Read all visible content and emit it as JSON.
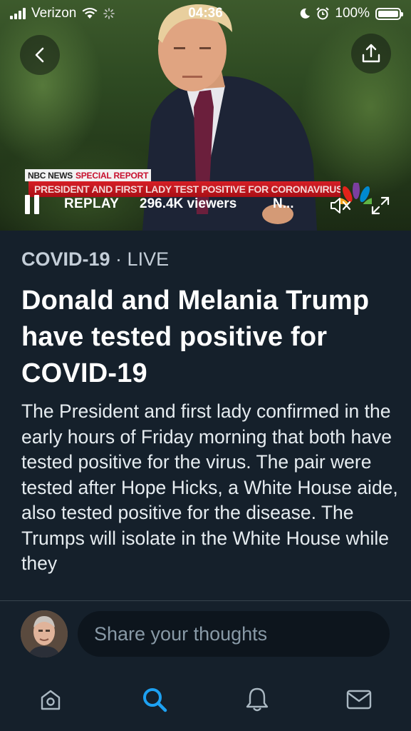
{
  "status_bar": {
    "carrier": "Verizon",
    "time": "04:36",
    "battery": "100%"
  },
  "video": {
    "banner_brand": "NBC NEWS",
    "banner_label": "SPECIAL REPORT",
    "ticker": "PRESIDENT AND FIRST LADY TEST POSITIVE FOR CORONAVIRUS",
    "replay_label": "REPLAY",
    "viewers": "296.4K viewers",
    "truncated_title": "N..."
  },
  "article": {
    "topic": "COVID-19",
    "separator": " · ",
    "live_label": "LIVE",
    "headline": "Donald and Melania Trump have tested positive for COVID-19",
    "body": "The President and first lady confirmed in the early hours of Friday morning that both have tested positive for the virus. The pair were tested after Hope Hicks, a White House aide, also tested positive for the disease. The Trumps will isolate in the White House while they"
  },
  "compose": {
    "placeholder": "Share your thoughts"
  },
  "tab_bar": {
    "active": "search",
    "accent_color": "#1da1f2",
    "icons": [
      "home-icon",
      "search-icon",
      "notifications-icon",
      "messages-icon"
    ]
  }
}
